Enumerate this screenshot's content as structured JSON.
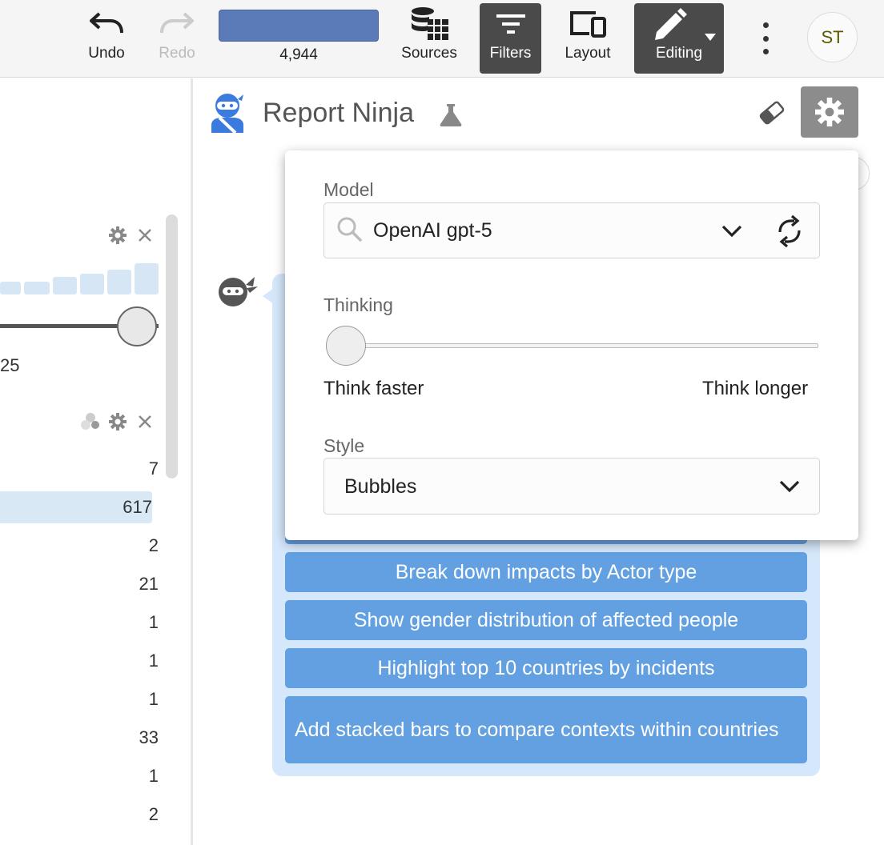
{
  "toolbar": {
    "undo_label": "Undo",
    "redo_label": "Redo",
    "record_count": "4,944",
    "sources_label": "Sources",
    "filters_label": "Filters",
    "layout_label": "Layout",
    "editing_label": "Editing",
    "avatar_initials": "ST"
  },
  "left_panel": {
    "slider_value_label": "25",
    "values": [
      "7",
      "617",
      "2",
      "21",
      "1",
      "1",
      "1",
      "33",
      "1",
      "2"
    ]
  },
  "report_ninja": {
    "title": "Report Ninja"
  },
  "settings": {
    "model_label": "Model",
    "model_value": "OpenAI gpt-5",
    "thinking_label": "Thinking",
    "thinking_level": 0,
    "think_faster_label": "Think faster",
    "think_longer_label": "Think longer",
    "style_label": "Style",
    "style_value": "Bubbles"
  },
  "suggestions": [
    "Break down impacts by Actor type",
    "Show gender distribution of affected people",
    "Highlight top 10 countries by incidents",
    "Add stacked bars to compare contexts within countries"
  ]
}
